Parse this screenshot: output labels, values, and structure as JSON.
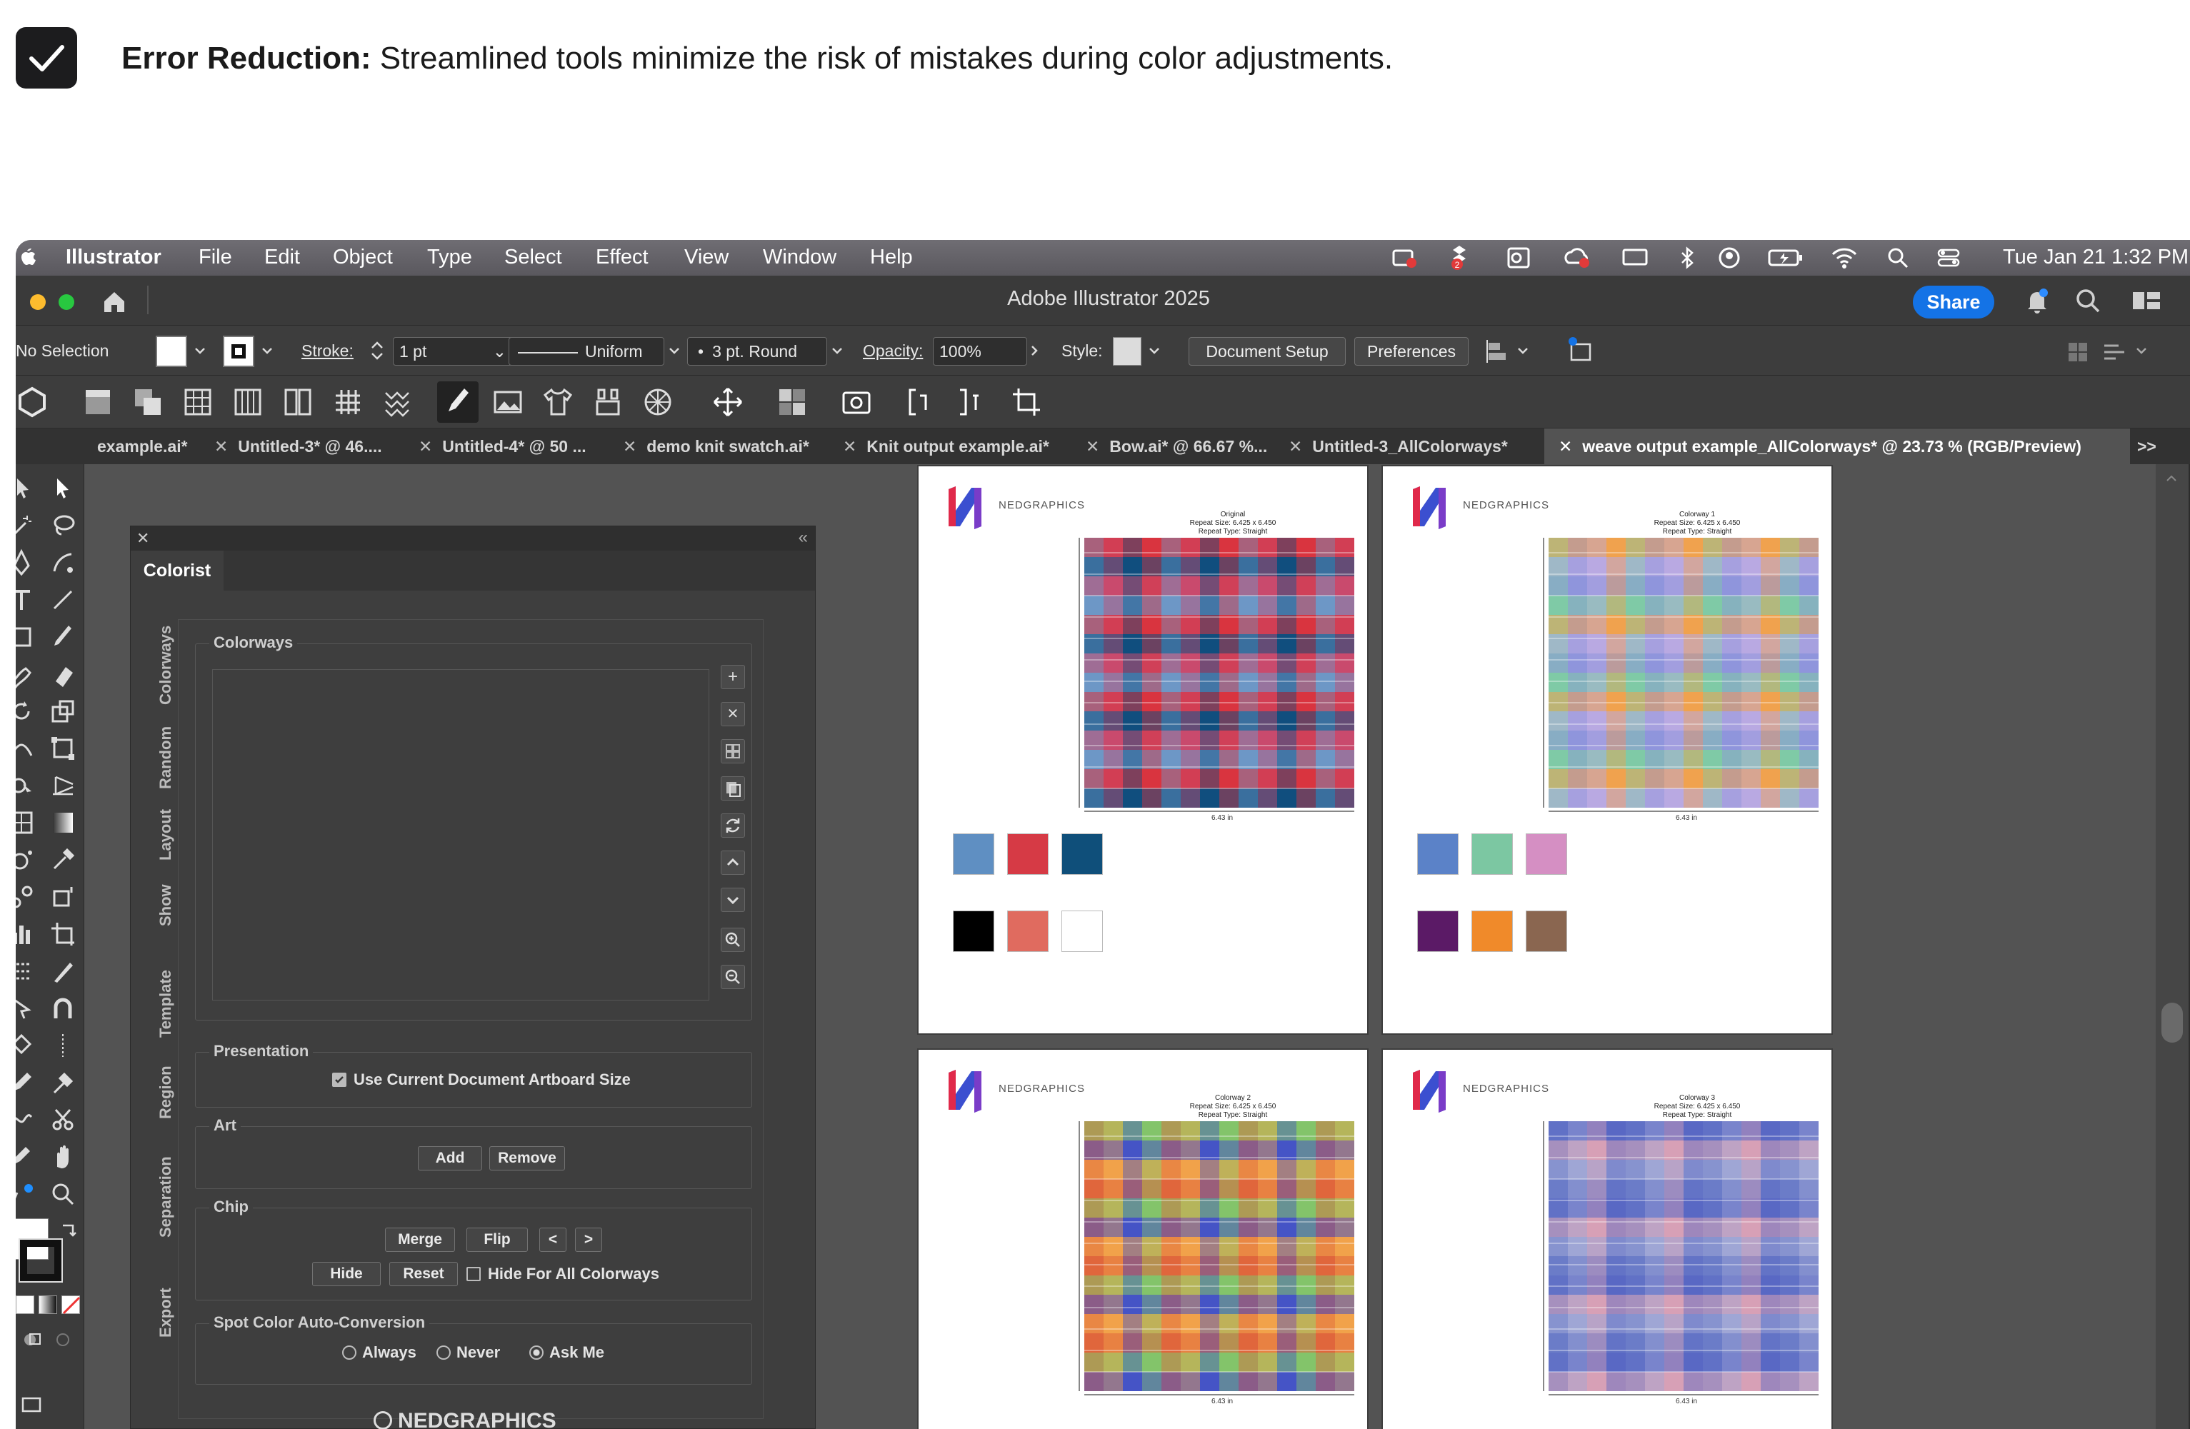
{
  "caption": {
    "bold": "Error Reduction:",
    "text": " Streamlined tools minimize the risk of mistakes during color adjustments."
  },
  "menubar": {
    "app": "Illustrator",
    "items": [
      "File",
      "Edit",
      "Object",
      "Type",
      "Select",
      "Effect",
      "View",
      "Window",
      "Help"
    ],
    "clock": "Tue Jan 21  1:32 PM",
    "badge": "2"
  },
  "titlebar": {
    "title": "Adobe Illustrator 2025",
    "share": "Share"
  },
  "control_bar": {
    "selection": "No Selection",
    "stroke_label": "Stroke:",
    "stroke_value": "1 pt",
    "profile": "Uniform",
    "brush": "3 pt. Round",
    "opacity_label": "Opacity:",
    "opacity_value": "100%",
    "style_label": "Style:",
    "document_setup": "Document Setup",
    "preferences": "Preferences"
  },
  "tabs": [
    {
      "label": "example.ai*"
    },
    {
      "label": "Untitled-3* @ 46...."
    },
    {
      "label": "Untitled-4* @ 50 ..."
    },
    {
      "label": "demo knit swatch.ai*"
    },
    {
      "label": "Knit output example.ai*"
    },
    {
      "label": "Bow.ai* @ 66.67 %..."
    },
    {
      "label": "Untitled-3_AllColorways*"
    },
    {
      "label": "weave output example_AllColorways* @ 23.73 % (RGB/Preview)"
    }
  ],
  "tabs_overflow": ">>",
  "colorist": {
    "title": "Colorist",
    "vertical_tabs": [
      "Colorways",
      "Random",
      "Layout",
      "Show",
      "Template",
      "Region",
      "Separation",
      "Export"
    ],
    "colorways_title": "Colorways",
    "presentation_title": "Presentation",
    "use_artboard": "Use Current Document Artboard Size",
    "art_title": "Art",
    "add": "Add",
    "remove": "Remove",
    "chip_title": "Chip",
    "merge": "Merge",
    "flip": "Flip",
    "prev": "<",
    "next": ">",
    "hide": "Hide",
    "reset": "Reset",
    "hide_all": "Hide For All Colorways",
    "spot_title": "Spot Color Auto-Conversion",
    "always": "Always",
    "never": "Never",
    "ask_me": "Ask Me",
    "footer_brand": "NEDGRAPHICS"
  },
  "artboards": [
    {
      "brand": "NEDGRAPHICS",
      "caption": "Original\nRepeat Size: 6.425 x 6.450\nRepeat Type: Straight",
      "ruler": "6.43 in",
      "colors": [
        "#5f8fc2",
        "#d63a45",
        "#0f4f7a",
        "#000000",
        "#e06b5f",
        "#ffffff"
      ],
      "palette": [
        "#6d98c6",
        "#d9343f",
        "#104f7e",
        "#c94b6e"
      ]
    },
    {
      "brand": "NEDGRAPHICS",
      "caption": "Colorway 1\nRepeat Size: 6.425 x 6.450\nRepeat Type: Straight",
      "ruler": "6.43 in",
      "colors": [
        "#5b82c8",
        "#7cc7a2",
        "#d58fc3",
        "#5b1a66",
        "#f08a2a",
        "#8a6650"
      ],
      "palette": [
        "#8f96dc",
        "#7fcaa6",
        "#f0a24e",
        "#b9a9e2"
      ]
    },
    {
      "brand": "NEDGRAPHICS",
      "caption": "Colorway 2\nRepeat Size: 6.425 x 6.450\nRepeat Type: Straight",
      "ruler": "6.43 in",
      "colors": [],
      "palette": [
        "#4654c6",
        "#f1a24a",
        "#e0663c",
        "#83c46a"
      ]
    },
    {
      "brand": "NEDGRAPHICS",
      "caption": "Colorway 3\nRepeat Size: 6.425 x 6.450\nRepeat Type: Straight",
      "ruler": "6.43 in",
      "colors": [],
      "palette": [
        "#5968c4",
        "#d7a0b6",
        "#9fa6d6",
        "#6c7cc8"
      ]
    }
  ]
}
